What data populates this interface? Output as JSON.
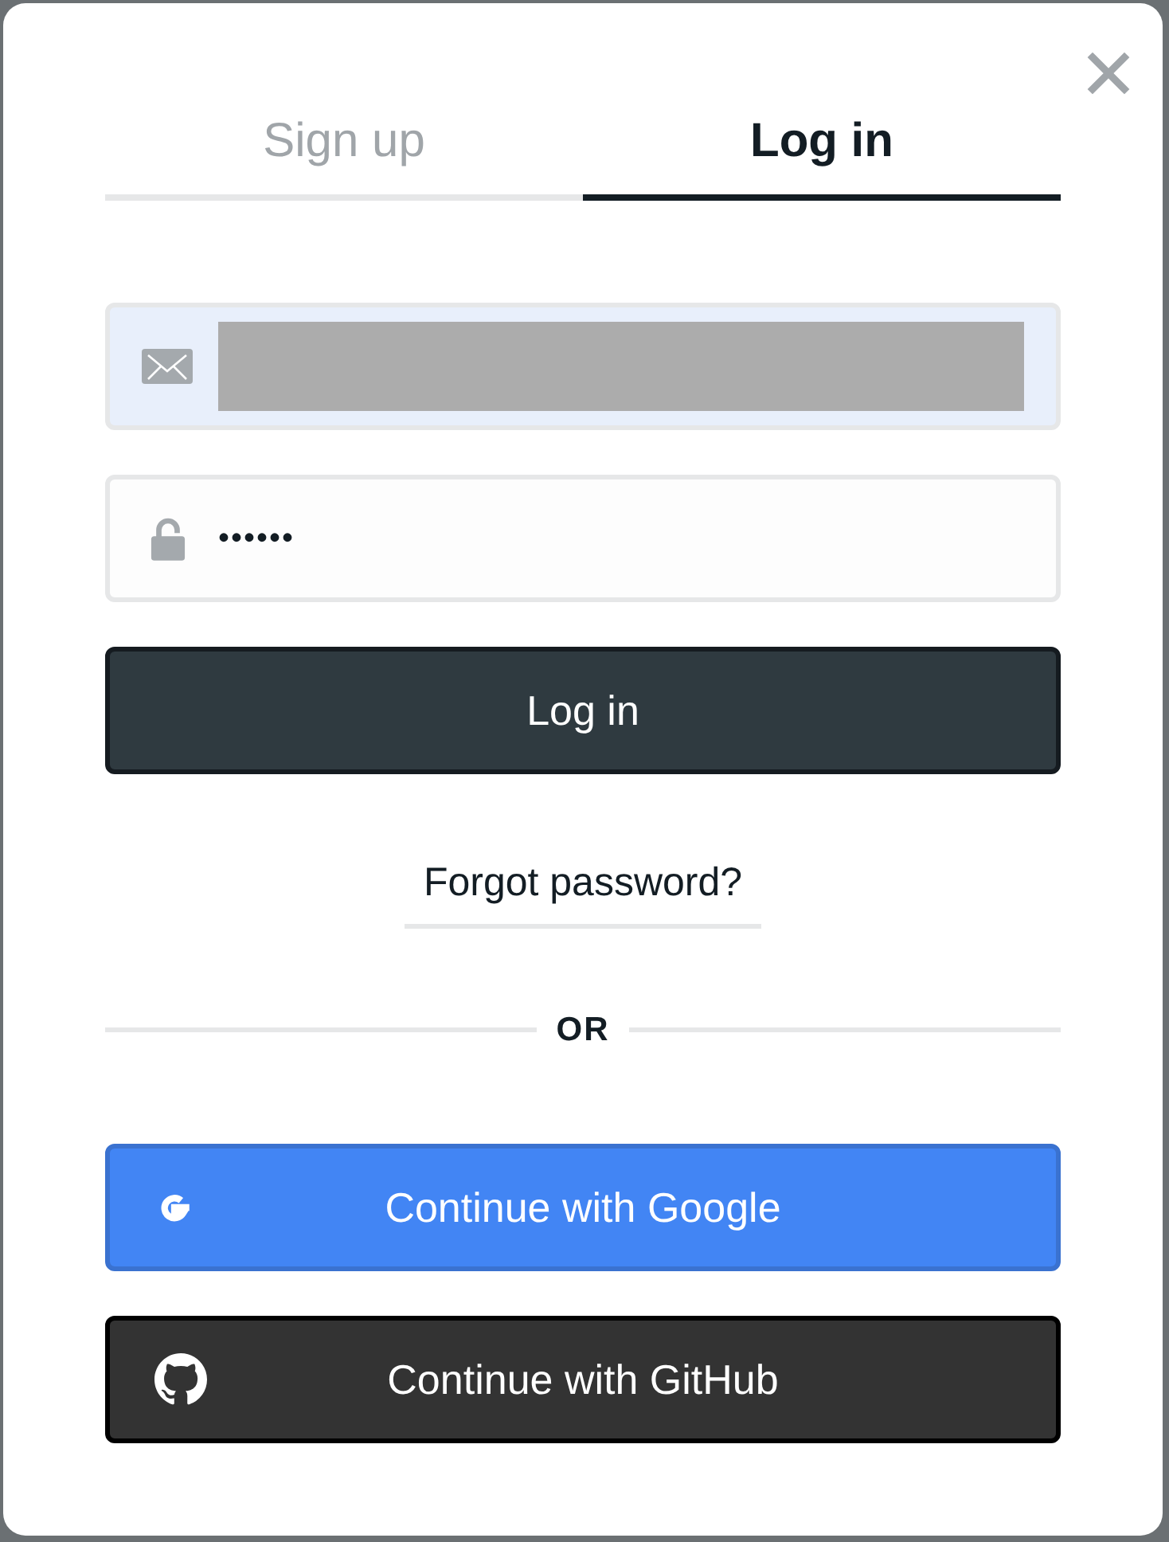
{
  "tabs": [
    {
      "label": "Sign up",
      "selected": false
    },
    {
      "label": "Log in",
      "selected": true
    }
  ],
  "email_field": {
    "autofilled": true,
    "redacted": true
  },
  "password_field": {
    "value": "••••••"
  },
  "login_button": {
    "label": "Log in"
  },
  "forgot_link": {
    "label": "Forgot password?"
  },
  "divider": {
    "label": "OR"
  },
  "social_buttons": [
    {
      "kind": "google",
      "label": "Continue with Google"
    },
    {
      "kind": "github",
      "label": "Continue with GitHub"
    }
  ]
}
